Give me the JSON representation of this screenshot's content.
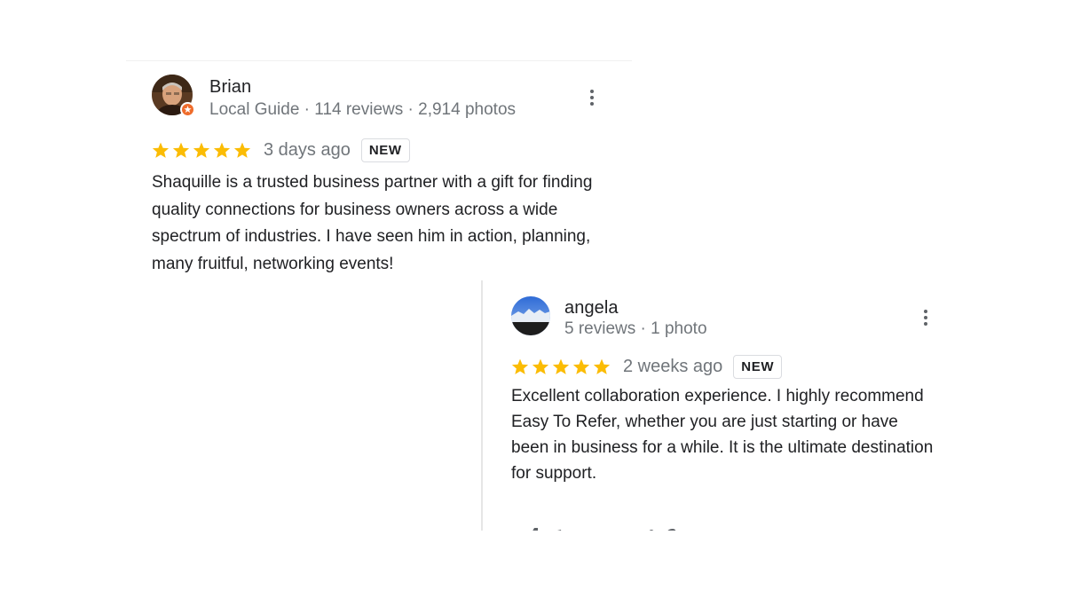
{
  "reviews": [
    {
      "name": "Brian",
      "meta": "Local Guide · 114 reviews · 2,914 photos",
      "stars": 5,
      "date": "3 days ago",
      "badge": "NEW",
      "text": "Shaquille is a trusted business partner with a gift for finding quality connections for business owners across a wide spectrum of industries. I have seen him in action, planning, many fruitful, networking events!"
    },
    {
      "name": "angela",
      "meta": "5 reviews · 1 photo",
      "stars": 5,
      "date": "2 weeks ago",
      "badge": "NEW",
      "text": "Excellent collaboration experience. I highly recommend Easy To Refer, whether you are just starting or have been in business for a while. It is the ultimate destination for support."
    }
  ],
  "icons": {
    "star": "star-icon",
    "more": "more-vert-icon",
    "local_guide": "local-guide-badge-icon"
  },
  "colors": {
    "star": "#fbbc04",
    "text": "#202124",
    "secondary": "#70757a",
    "local_guide_badge": "#ef6c2b"
  }
}
